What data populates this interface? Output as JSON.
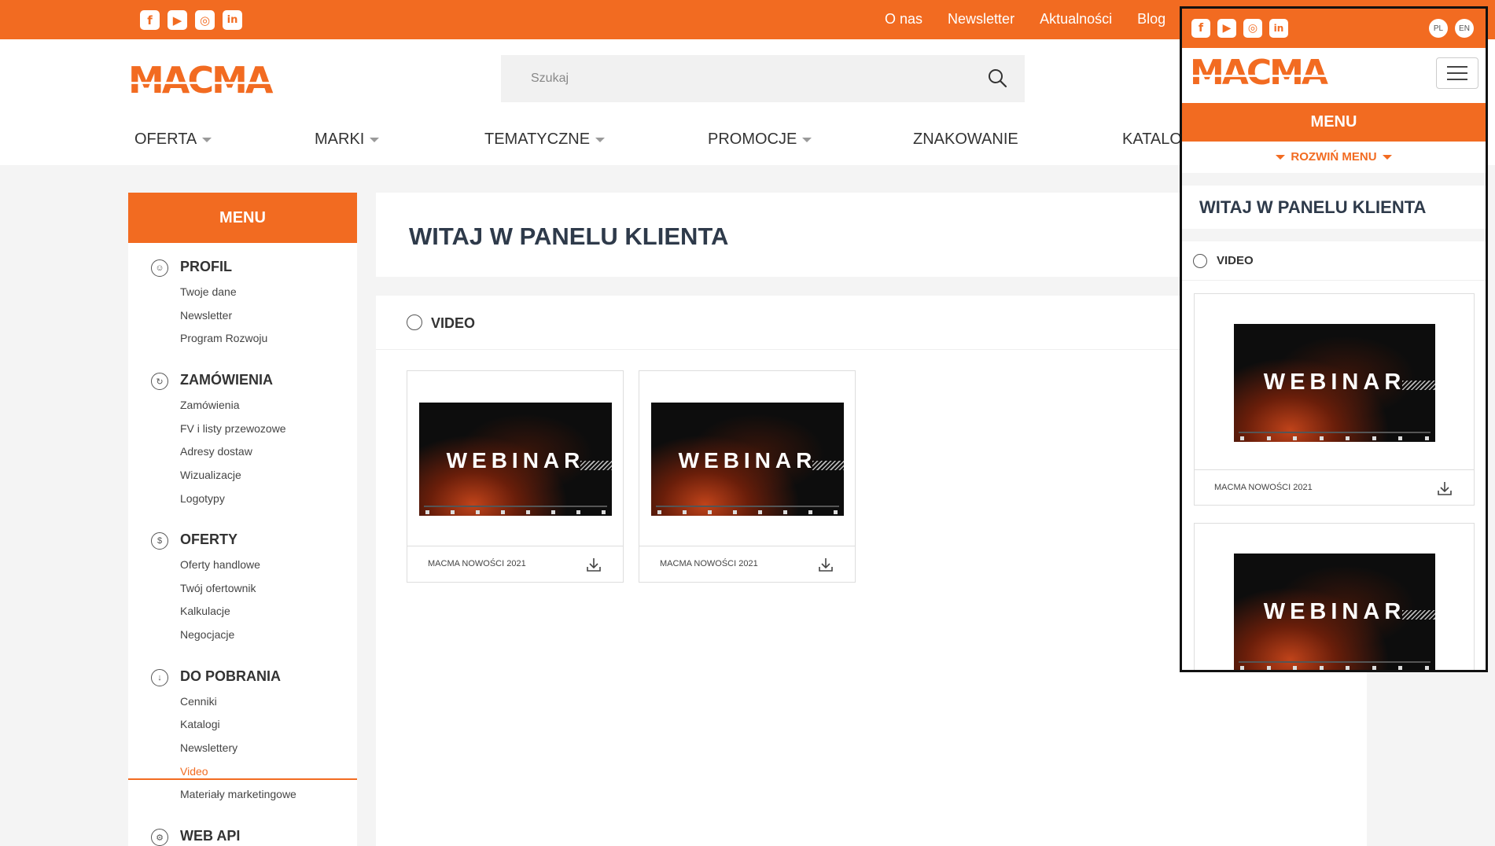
{
  "brand": {
    "logo_text": "MACMA",
    "accent": "#f26b21"
  },
  "social_icons": [
    "facebook-icon",
    "youtube-icon",
    "instagram-icon",
    "linkedin-icon"
  ],
  "top_links": [
    "O nas",
    "Newsletter",
    "Aktualności",
    "Blog"
  ],
  "search": {
    "placeholder": "Szukaj"
  },
  "main_nav": [
    {
      "label": "OFERTA",
      "dropdown": true
    },
    {
      "label": "MARKI",
      "dropdown": true
    },
    {
      "label": "TEMATYCZNE",
      "dropdown": true
    },
    {
      "label": "PROMOCJE",
      "dropdown": true
    },
    {
      "label": "ZNAKOWANIE",
      "dropdown": false
    },
    {
      "label": "KATALOG",
      "dropdown": false
    }
  ],
  "sidebar": {
    "title": "MENU",
    "sections": [
      {
        "title": "PROFIL",
        "icon": "user-icon",
        "items": [
          "Twoje dane",
          "Newsletter",
          "Program Rozwoju"
        ]
      },
      {
        "title": "ZAMÓWIENIA",
        "icon": "orders-icon",
        "items": [
          "Zamówienia",
          "FV i listy przewozowe",
          "Adresy dostaw",
          "Wizualizacje",
          "Logotypy"
        ]
      },
      {
        "title": "OFERTY",
        "icon": "offers-icon",
        "items": [
          "Oferty handlowe",
          "Twój ofertownik",
          "Kalkulacje",
          "Negocjacje"
        ]
      },
      {
        "title": "DO POBRANIA",
        "icon": "download-icon",
        "items": [
          "Cenniki",
          "Katalogi",
          "Newslettery",
          "Video",
          "Materiały marketingowe"
        ],
        "active": "Video"
      },
      {
        "title": "WEB API",
        "icon": "api-icon",
        "items": []
      }
    ]
  },
  "main": {
    "welcome_title": "WITAJ W PANELU KLIENTA",
    "video_section_title": "VIDEO",
    "videos": [
      {
        "thumb_text": "WEBINAR",
        "label": "MACMA NOWOŚCI 2021"
      },
      {
        "thumb_text": "WEBINAR",
        "label": "MACMA NOWOŚCI 2021"
      }
    ]
  },
  "mobile": {
    "languages": [
      "PL",
      "EN"
    ],
    "menu_label": "MENU",
    "expand_label": "ROZWIŃ MENU",
    "welcome_title": "WITAJ W PANELU KLIENTA",
    "video_section_title": "VIDEO",
    "videos": [
      {
        "thumb_text": "WEBINAR",
        "label": "MACMA NOWOŚCI 2021"
      },
      {
        "thumb_text": "WEBINAR",
        "label": ""
      }
    ]
  }
}
